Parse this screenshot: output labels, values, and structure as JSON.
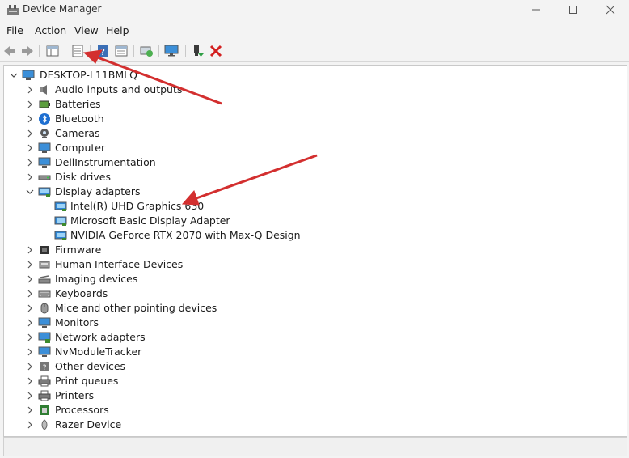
{
  "window": {
    "title": "Device Manager"
  },
  "menu": {
    "file": "File",
    "action": "Action",
    "view": "View",
    "help": "Help"
  },
  "toolbar": [
    "back-arrow-icon",
    "forward-arrow-icon",
    "show-hide-console-tree-icon",
    "properties-icon",
    "help-icon",
    "update-view-icon",
    "scan-hardware-icon",
    "monitor-icon",
    "enable-device-icon",
    "uninstall-device-icon"
  ],
  "tree": {
    "root": "DESKTOP-L11BMLQ",
    "categories": [
      {
        "label": "Audio inputs and outputs",
        "icon": "speaker-icon"
      },
      {
        "label": "Batteries",
        "icon": "battery-icon"
      },
      {
        "label": "Bluetooth",
        "icon": "bluetooth-icon"
      },
      {
        "label": "Cameras",
        "icon": "camera-icon"
      },
      {
        "label": "Computer",
        "icon": "computer-icon"
      },
      {
        "label": "DellInstrumentation",
        "icon": "computer-icon"
      },
      {
        "label": "Disk drives",
        "icon": "disk-icon"
      },
      {
        "label": "Display adapters",
        "icon": "display-adapter-icon"
      },
      {
        "label": "Intel(R) UHD Graphics 630",
        "icon": "display-adapter-icon"
      },
      {
        "label": "Microsoft Basic Display Adapter",
        "icon": "display-adapter-icon"
      },
      {
        "label": "NVIDIA GeForce RTX 2070 with Max-Q Design",
        "icon": "display-adapter-icon"
      },
      {
        "label": "Firmware",
        "icon": "chip-icon"
      },
      {
        "label": "Human Interface Devices",
        "icon": "hid-icon"
      },
      {
        "label": "Imaging devices",
        "icon": "scanner-icon"
      },
      {
        "label": "Keyboards",
        "icon": "keyboard-icon"
      },
      {
        "label": "Mice and other pointing devices",
        "icon": "mouse-icon"
      },
      {
        "label": "Monitors",
        "icon": "monitor-icon"
      },
      {
        "label": "Network adapters",
        "icon": "network-icon"
      },
      {
        "label": "NvModuleTracker",
        "icon": "computer-icon"
      },
      {
        "label": "Other devices",
        "icon": "unknown-device-icon"
      },
      {
        "label": "Print queues",
        "icon": "printer-icon"
      },
      {
        "label": "Printers",
        "icon": "printer-icon"
      },
      {
        "label": "Processors",
        "icon": "processor-icon"
      },
      {
        "label": "Razer Device",
        "icon": "razer-icon"
      }
    ]
  },
  "colors": {
    "annotation_arrow": "#d32f2f",
    "accent": "#2b88d8"
  }
}
